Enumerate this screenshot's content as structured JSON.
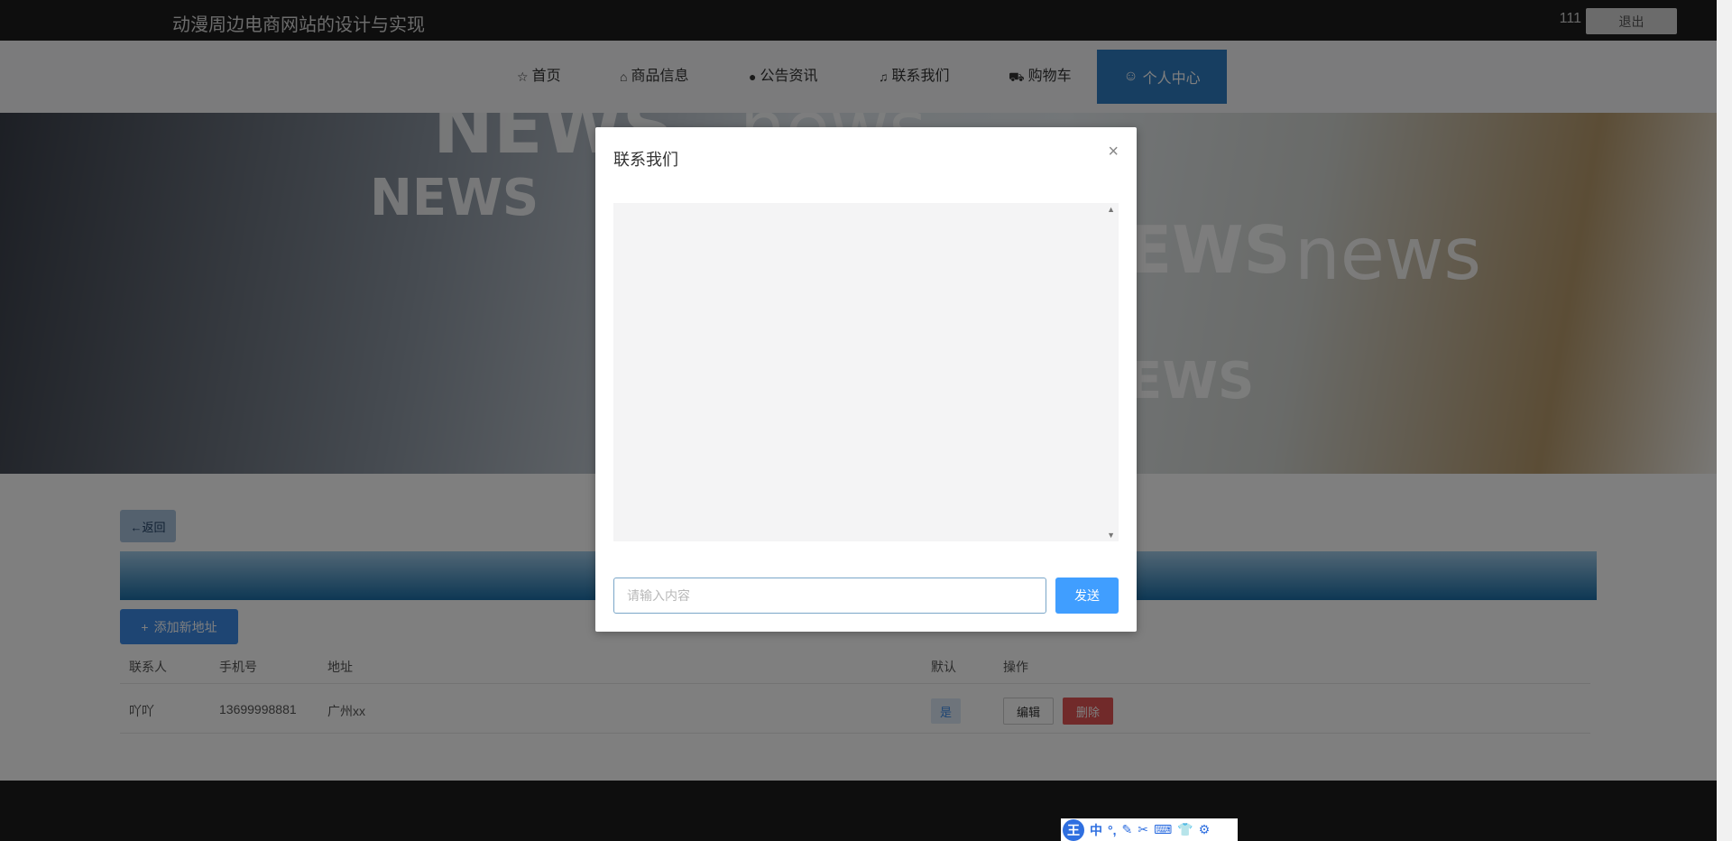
{
  "header": {
    "site_title": "动漫周边电商网站的设计与实现",
    "user_name": "111",
    "logout_label": "退出"
  },
  "nav": {
    "items": [
      {
        "icon": "star-icon",
        "label": "首页"
      },
      {
        "icon": "bag-icon",
        "label": "商品信息"
      },
      {
        "icon": "alert-icon",
        "label": "公告资讯"
      },
      {
        "icon": "headset-icon",
        "label": "联系我们"
      },
      {
        "icon": "cart-icon",
        "label": "购物车"
      }
    ],
    "active": {
      "icon": "user-icon",
      "label": "个人中心"
    }
  },
  "banner": {
    "words": [
      "NEWS",
      "news",
      "NEWS",
      "EWS",
      "news",
      "EWS"
    ]
  },
  "address_page": {
    "back_label": "←返回",
    "add_label": "添加新地址",
    "columns": [
      "联系人",
      "手机号",
      "地址",
      "默认",
      "操作"
    ],
    "rows": [
      {
        "contact": "吖吖",
        "phone": "13699998881",
        "address": "广州xx",
        "default": "是",
        "edit_label": "编辑",
        "delete_label": "删除"
      }
    ]
  },
  "modal": {
    "title": "联系我们",
    "close_icon": "close-icon",
    "input_placeholder": "请输入内容",
    "send_label": "发送"
  },
  "ime": {
    "logo": "王",
    "mode": "中",
    "items": [
      "°,",
      "pen-icon",
      "scissors-icon",
      "keyboard-icon",
      "shirt-icon",
      "gear-icon"
    ]
  },
  "colors": {
    "accent": "#2f7dc3",
    "send": "#409eff",
    "delete": "#e25555",
    "topbar": "#1c1c1c"
  }
}
